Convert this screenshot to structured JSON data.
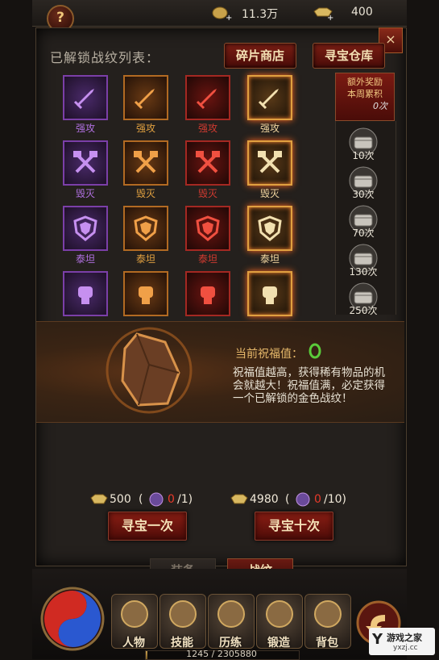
{
  "currency": {
    "gold": "11.3万",
    "ingot": "400"
  },
  "header": {
    "list_title": "已解锁战纹列表：",
    "shard_shop": "碎片商店",
    "warehouse": "寻宝仓库",
    "close": "×",
    "help": "?"
  },
  "grid": {
    "rows": [
      {
        "label": "强攻",
        "icon": "sword-icon"
      },
      {
        "label": "毁灭",
        "icon": "crossed-axes-icon"
      },
      {
        "label": "泰坦",
        "icon": "shield-icon"
      },
      {
        "label": "",
        "icon": "fist-icon"
      }
    ],
    "rarities": [
      "purple",
      "orange",
      "red",
      "gold"
    ]
  },
  "bonus": {
    "title_line1": "额外奖励",
    "title_line2": "本周累积",
    "count": "0次",
    "chests": [
      "10次",
      "30次",
      "70次",
      "130次",
      "250次"
    ]
  },
  "blessing": {
    "label": "当前祝福值：",
    "value": "0",
    "description": "祝福值越高，获得稀有物品的机会就越大！祝福值满，必定获得一个已解锁的金色战纹！"
  },
  "draw_once": {
    "cost": "500",
    "open_paren": "(",
    "have": "0",
    "need": "/1)",
    "button": "寻宝一次"
  },
  "draw_ten": {
    "cost": "4980",
    "open_paren": "(",
    "have": "0",
    "need": "/10)",
    "button": "寻宝十次"
  },
  "tabs": {
    "equip": "装备",
    "battle_pattern": "战纹"
  },
  "nav": [
    "人物",
    "技能",
    "历练",
    "锻造",
    "背包"
  ],
  "exp": {
    "text": "1245 / 2305880",
    "progress": 0.00054
  },
  "watermark": {
    "brand": "游戏之家",
    "url": "yxzj.cc"
  },
  "colors": {
    "gold": "#f2d6a0",
    "red": "#d03a30",
    "purple": "#b070e0",
    "orange": "#e0a040"
  }
}
